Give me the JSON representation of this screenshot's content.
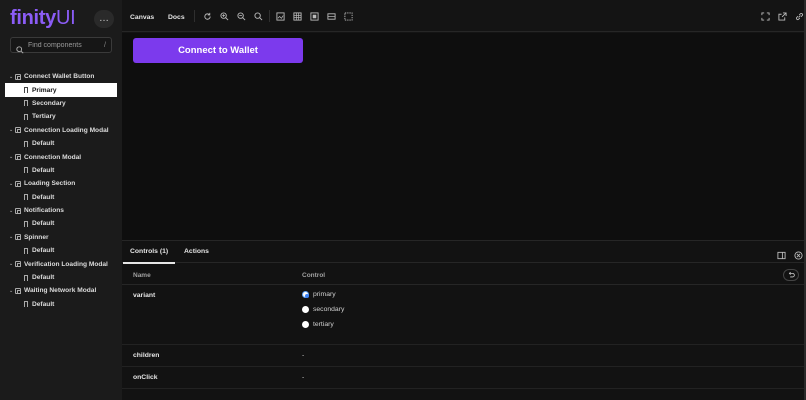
{
  "brand": {
    "name_bold": "finity",
    "name_light": "UI",
    "more_label": "…"
  },
  "search": {
    "placeholder": "Find components",
    "shortcut": "/"
  },
  "tree": {
    "groups": [
      {
        "label": "Connect Wallet Button",
        "stories": [
          "Primary",
          "Secondary",
          "Tertiary"
        ]
      },
      {
        "label": "Connection Loading Modal",
        "stories": [
          "Default"
        ]
      },
      {
        "label": "Connection Modal",
        "stories": [
          "Default"
        ]
      },
      {
        "label": "Loading Section",
        "stories": [
          "Default"
        ]
      },
      {
        "label": "Notifications",
        "stories": [
          "Default"
        ]
      },
      {
        "label": "Spinner",
        "stories": [
          "Default"
        ]
      },
      {
        "label": "Verification Loading Modal",
        "stories": [
          "Default"
        ]
      },
      {
        "label": "Waiting Network Modal",
        "stories": [
          "Default"
        ]
      }
    ],
    "selected": "Primary"
  },
  "toolbar": {
    "tab_canvas": "Canvas",
    "tab_docs": "Docs"
  },
  "canvas": {
    "button_label": "Connect to Wallet"
  },
  "panel": {
    "tab_controls": "Controls (1)",
    "tab_actions": "Actions",
    "col_name": "Name",
    "col_control": "Control",
    "rows": {
      "variant": {
        "name": "variant",
        "options": [
          "primary",
          "secondary",
          "tertiary"
        ],
        "selected": "primary"
      },
      "children": {
        "name": "children",
        "value": "-"
      },
      "onclick": {
        "name": "onClick",
        "value": "-"
      }
    }
  },
  "colors": {
    "accent": "#7c3aed",
    "brand": "#8b5cf6",
    "radio_selected": "#3b82f6"
  }
}
